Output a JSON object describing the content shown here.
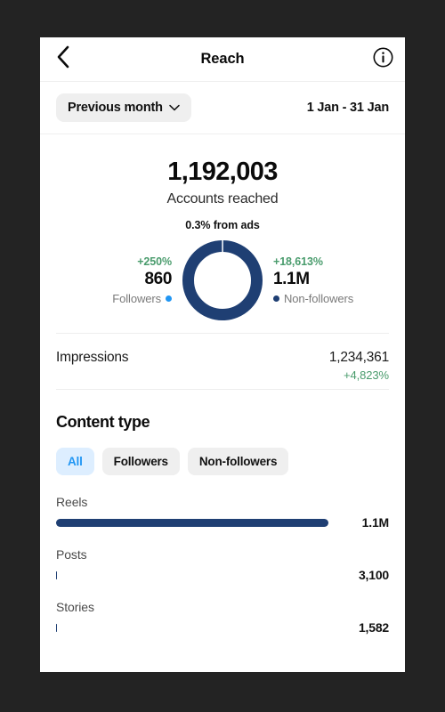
{
  "colors": {
    "page_background": "#232323",
    "card_background": "#ffffff",
    "followers": "#2196f3",
    "non_followers": "#1f3f73",
    "positive": "#4a9c6d",
    "chip_selected_bg": "#ddeeff",
    "chip_bg": "#efefef"
  },
  "navbar": {
    "back_icon": "chevron-left-icon",
    "title": "Reach",
    "info_icon": "info-circle-icon"
  },
  "period": {
    "selector_label": "Previous month",
    "selector_icon": "chevron-down-icon",
    "range": "1 Jan - 31 Jan"
  },
  "hero": {
    "value": "1,192,003",
    "label": "Accounts reached",
    "sub": "0.3% from ads"
  },
  "breakdown": {
    "followers": {
      "delta": "+250%",
      "value": "860",
      "name": "Followers",
      "dot_icon": "legend-dot-icon"
    },
    "non_followers": {
      "delta": "+18,613%",
      "value": "1.1M",
      "name": "Non-followers",
      "dot_icon": "legend-dot-icon"
    }
  },
  "impressions": {
    "name": "Impressions",
    "value": "1,234,361",
    "delta": "+4,823%"
  },
  "content_type": {
    "title": "Content type",
    "chips": [
      {
        "label": "All",
        "selected": true
      },
      {
        "label": "Followers",
        "selected": false
      },
      {
        "label": "Non-followers",
        "selected": false
      }
    ]
  },
  "chart_data": {
    "type": "bar",
    "title": "Content type",
    "orientation": "horizontal",
    "categories": [
      "Reels",
      "Posts",
      "Stories"
    ],
    "values": [
      1100000,
      3100,
      1582
    ],
    "value_labels": [
      "1.1M",
      "3,100",
      "1,582"
    ],
    "bar_percent": [
      100,
      0.28,
      0.14
    ],
    "xlabel": "",
    "ylabel": "",
    "xlim": [
      0,
      1100000
    ],
    "grid": false,
    "legend": "none",
    "series_color": "#1f3f73"
  },
  "donut_chart": {
    "type": "pie",
    "title": "Accounts reached",
    "labels": [
      "Non-followers",
      "Followers"
    ],
    "values": [
      1100000,
      860
    ],
    "percentages": [
      99.92,
      0.08
    ],
    "colors": [
      "#1f3f73",
      "#2196f3"
    ],
    "inner_radius_ratio": 0.71,
    "legend": "sides"
  }
}
